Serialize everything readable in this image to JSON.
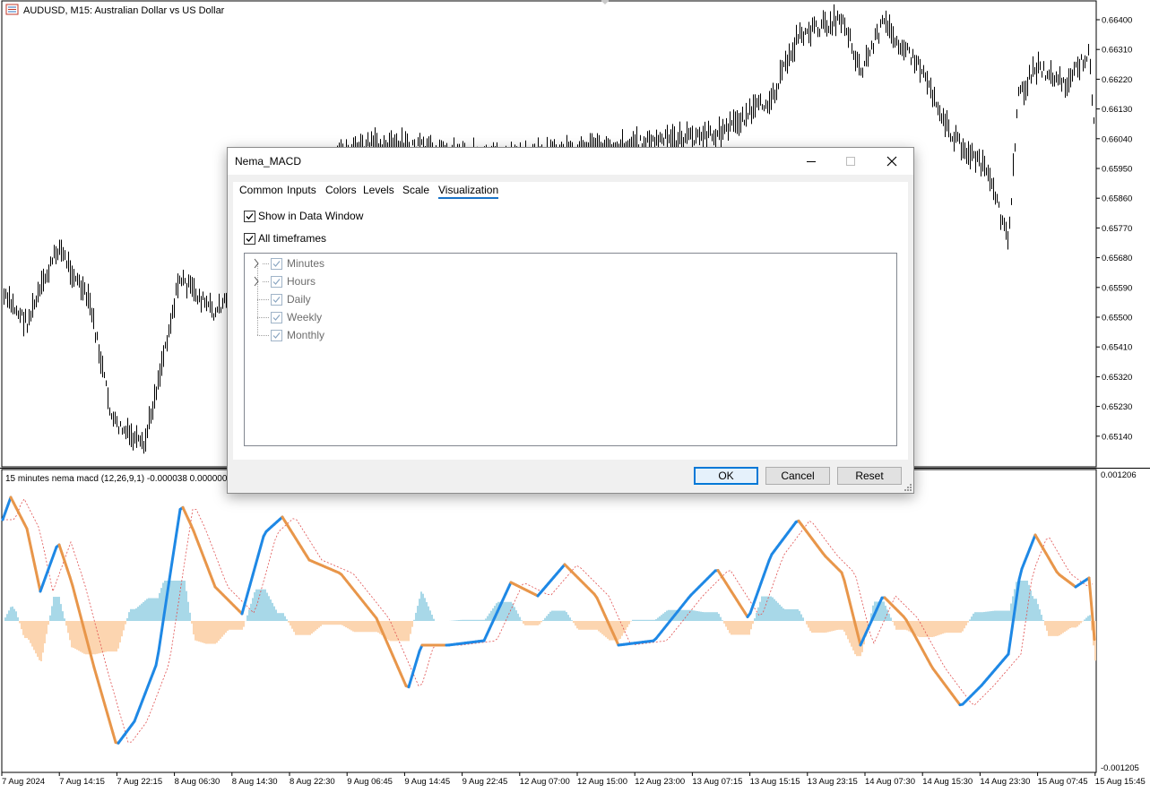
{
  "main_chart": {
    "symbol_label": "AUDUSD, M15:  Australian Dollar vs US Dollar",
    "price_ticks": [
      "0.66400",
      "0.66310",
      "0.66220",
      "0.66130",
      "0.66040",
      "0.65950",
      "0.65860",
      "0.65770",
      "0.65680",
      "0.65590",
      "0.65500",
      "0.65410",
      "0.65320",
      "0.65230",
      "0.65140"
    ]
  },
  "indicator_panel": {
    "label": "15 minutes nema macd (12,26,9,1) -0.000038 0.000000 0.000",
    "scale_top": "0.001206",
    "scale_bottom": "-0.001205",
    "colors": {
      "macd_up": "#1e88e5",
      "macd_down": "#e8964a",
      "hist_pos": "#a8d8e8",
      "hist_neg": "#fcd5b0",
      "signal": "#e05050"
    }
  },
  "time_axis": {
    "labels": [
      "7 Aug 2024",
      "7 Aug 14:15",
      "7 Aug 22:15",
      "8 Aug 06:30",
      "8 Aug 14:30",
      "8 Aug 22:30",
      "9 Aug 06:45",
      "9 Aug 14:45",
      "9 Aug 22:45",
      "12 Aug 07:00",
      "12 Aug 15:00",
      "12 Aug 23:00",
      "13 Aug 07:15",
      "13 Aug 15:15",
      "13 Aug 23:15",
      "14 Aug 07:30",
      "14 Aug 15:30",
      "14 Aug 23:30",
      "15 Aug 07:45",
      "15 Aug 15:45"
    ]
  },
  "dialog": {
    "title": "Nema_MACD",
    "tabs": [
      "Common",
      "Inputs",
      "Colors",
      "Levels",
      "Scale",
      "Visualization"
    ],
    "active_tab": "Visualization",
    "show_in_data_window": {
      "label": "Show in Data Window",
      "checked": true
    },
    "all_timeframes": {
      "label": "All timeframes",
      "checked": true
    },
    "timeframes": [
      {
        "label": "Minutes",
        "checked": true,
        "expandable": true
      },
      {
        "label": "Hours",
        "checked": true,
        "expandable": true
      },
      {
        "label": "Daily",
        "checked": true,
        "expandable": false
      },
      {
        "label": "Weekly",
        "checked": true,
        "expandable": false
      },
      {
        "label": "Monthly",
        "checked": true,
        "expandable": false
      }
    ],
    "buttons": {
      "ok": "OK",
      "cancel": "Cancel",
      "reset": "Reset"
    }
  }
}
